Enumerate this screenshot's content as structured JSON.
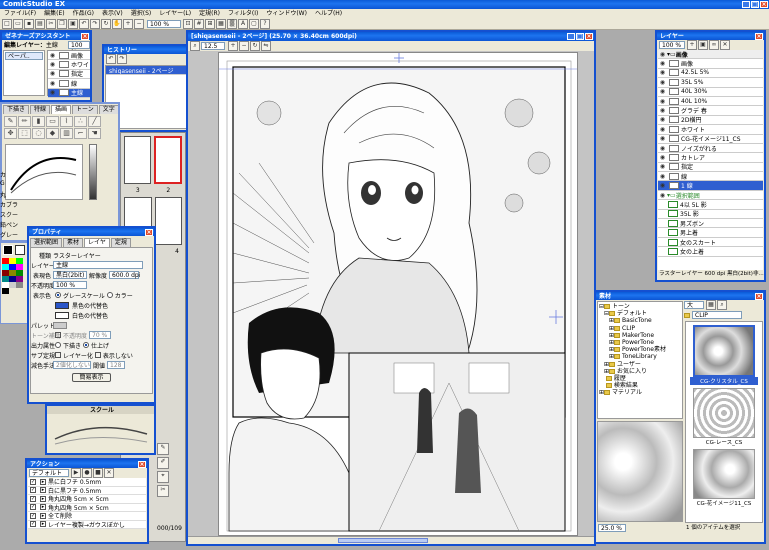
{
  "app": {
    "title": "ComicStudio EX",
    "menu": [
      "ファイル(F)",
      "編集(E)",
      "作品(G)",
      "表示(V)",
      "選択(S)",
      "レイヤー(L)",
      "定規(R)",
      "フィルタ(I)",
      "ウィンドウ(W)",
      "ヘルプ(H)"
    ],
    "zoom_toolbar": "100 %"
  },
  "navigator": {
    "title": "ゼネナーズアシスタント",
    "edit_layer_label": "編集レイヤー：",
    "edit_layer_value": "主線",
    "opacity": "100 %",
    "dropdown": "ペーパ.."
  },
  "quick_layers": {
    "items": [
      "画像",
      "ホワイト",
      "指定",
      "線",
      "主線"
    ],
    "selected_index": 4
  },
  "history": {
    "title": "ヒストリー",
    "entry": "shiqasenseii - 2ページ"
  },
  "canvas": {
    "title": "[shiqasenseii - 2ページ] (25.70 × 36.40cm 600dpi)",
    "zoom": "12.5"
  },
  "tools": {
    "tabs": [
      "下描き",
      "特線",
      "描画",
      "トーン",
      "文字"
    ],
    "active_tab": "描画",
    "side_labels": [
      "カ",
      "G",
      "丸",
      "カブラ",
      "スクー",
      "鉛ペン",
      "グレー"
    ]
  },
  "page_thumbs": {
    "labels": [
      "3",
      "2",
      "4",
      "000/109"
    ]
  },
  "properties": {
    "title": "プロパティ",
    "tabs": [
      "選択範囲",
      "素材",
      "レイヤ",
      "定規"
    ],
    "active_tab": "レイヤ",
    "type_label": "種類",
    "type_value": "ラスターレイヤー",
    "name_label": "レイヤー名",
    "name_value": "主線",
    "color_label": "表現色",
    "color_value": "黒白(2bit)",
    "resolution_label": "解像度",
    "resolution_value": "600.0 dpi",
    "opacity_label": "不透明度",
    "opacity_value": "100 %",
    "display_label": "表示色",
    "display_options": [
      "グレースケール",
      "カラー"
    ],
    "black_sub": "黒色の代替色",
    "white_sub": "白色の代替色",
    "palette_label": "パレット色",
    "tone_label": "トーン補助",
    "opacity2_label": "不透明度",
    "opacity2_value": "70 %",
    "output_label": "出力属性",
    "output_options": [
      "下描き",
      "仕上げ"
    ],
    "sub_label": "サブ定規",
    "sub_options": [
      "レイヤー化",
      "表示しない"
    ],
    "reduce_label": "減色手法",
    "reduce_value": "2値化しない",
    "threshold_label": "閾値",
    "threshold_value": "128",
    "simple_button": "簡易表示"
  },
  "scale_panel": {
    "title": "スクール"
  },
  "actions": {
    "title": "アクション",
    "set": "デフォルト",
    "items": [
      "黒に白フチ 0.5mm",
      "白に黒フチ 0.5mm",
      "角丸四角 5cm × 5cm",
      "角丸四角 5cm × 5cm",
      "全て削除",
      "レイヤー複製→ガウスぼかし"
    ]
  },
  "layers": {
    "title": "レイヤー",
    "opacity": "100 %",
    "folder": "画像",
    "items": [
      "画像",
      "42.5L 5%",
      "35L 5%",
      "40L 30%",
      "40L 10%",
      "グラデ 春",
      "2D横円",
      "ホワイト",
      "CG-花イメージ11_CS",
      "ノイズがれる",
      "カトレア",
      "指定",
      "線",
      "1 線"
    ],
    "selected_index": 13,
    "selection_folder": "選択範囲",
    "selection_items": [
      "4以 5L 影",
      "35L 影",
      "男ズボン",
      "男上着",
      "女のスカート",
      "女の上着"
    ],
    "status": "ラスターレイヤー 600 dpi 黒白(2bit)非..."
  },
  "materials": {
    "title": "素材",
    "tree": [
      "トーン",
      "デフォルト",
      "BasicTone",
      "CLIP",
      "MakerTone",
      "PowerTone",
      "PowerTone素材",
      "ToneLibrary",
      "ユーザー",
      "お気に入り",
      "履歴",
      "検索結果",
      "マテリアル"
    ],
    "size_option": "大",
    "folder_value": "CLIP",
    "items": [
      "CG-クリスタル_CS",
      "CG-レース_CS",
      "CG-花イメージ11_CS"
    ],
    "zoom": "25.0 %",
    "status": "1 個のアイテムを選択"
  },
  "colors": {
    "accent": "#1450d0",
    "title_blue": "#0a5ad7",
    "selection": "#2f5fd0",
    "panel": "#ece9d8"
  }
}
